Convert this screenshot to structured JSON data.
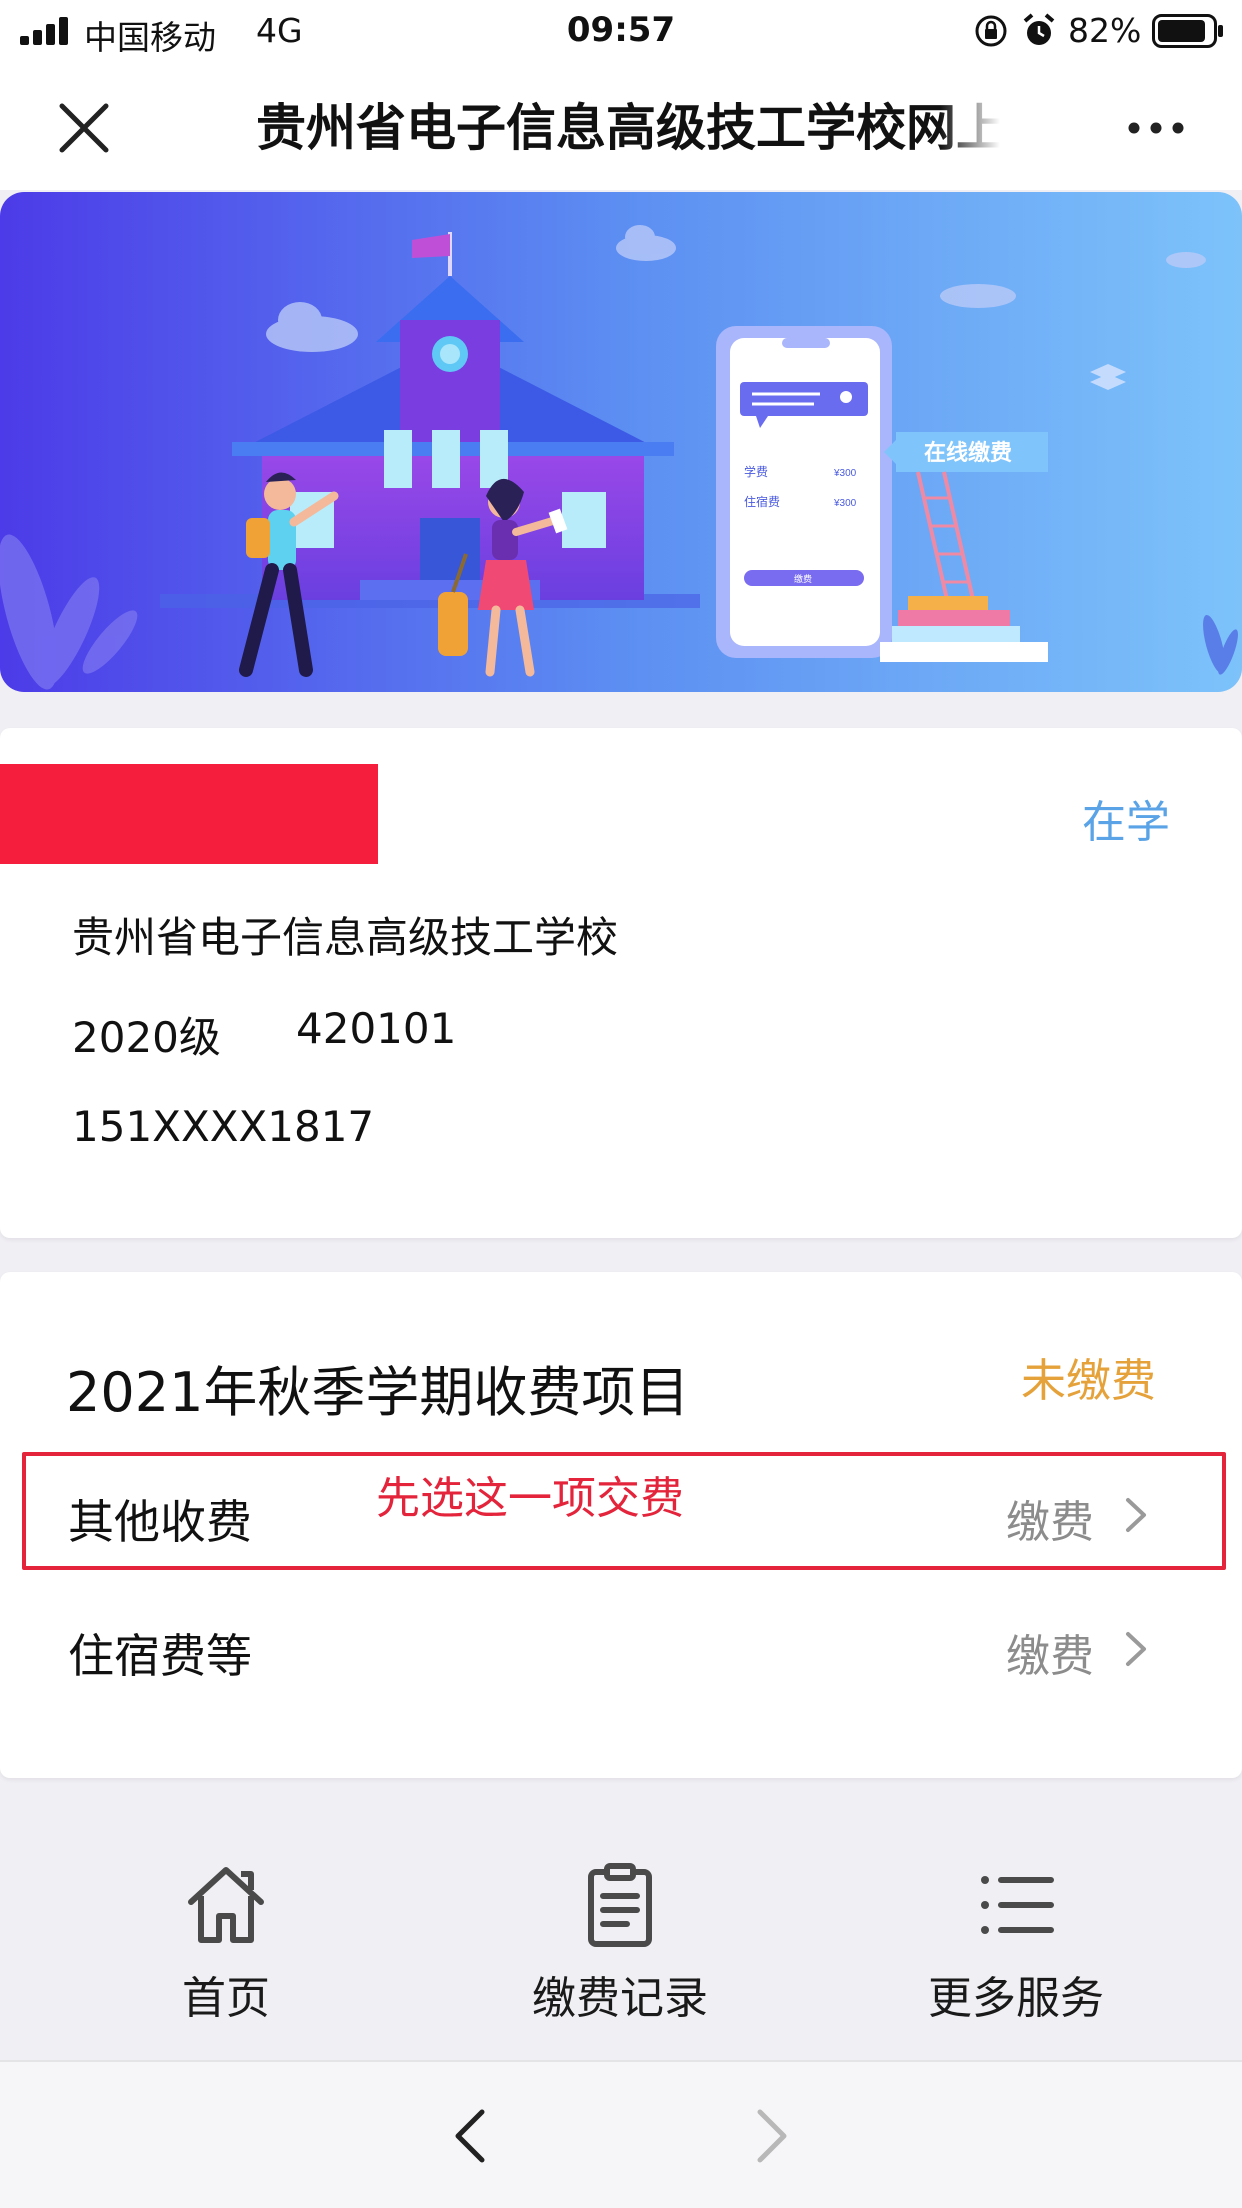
{
  "status_bar": {
    "carrier": "中国移动",
    "network": "4G",
    "time": "09:57",
    "battery": "82%"
  },
  "nav": {
    "title": "贵州省电子信息高级技工学校网上"
  },
  "banner": {
    "slogan": "在线缴费",
    "phone_fee_1_label": "学费",
    "phone_fee_1_value": "¥300",
    "phone_fee_2_label": "住宿费",
    "phone_fee_2_value": "¥300",
    "phone_button": "缴费"
  },
  "student": {
    "status": "在学",
    "school": "贵州省电子信息高级技工学校",
    "grade": "2020级",
    "code": "420101",
    "phone": "151XXXX1817"
  },
  "fees": {
    "title": "2021年秋季学期收费项目",
    "status": "未缴费",
    "items": [
      {
        "label": "其他收费",
        "action": "缴费"
      },
      {
        "label": "住宿费等",
        "action": "缴费"
      }
    ],
    "annotation": "先选这一项交费"
  },
  "tabs": [
    {
      "label": "首页",
      "icon": "home-icon"
    },
    {
      "label": "缴费记录",
      "icon": "clipboard-icon"
    },
    {
      "label": "更多服务",
      "icon": "list-icon"
    }
  ],
  "colors": {
    "status_blue": "#5aa3e6",
    "unpaid_orange": "#e6a23a",
    "annotation_red": "#e3243b",
    "redaction_red": "#f51f3d"
  }
}
